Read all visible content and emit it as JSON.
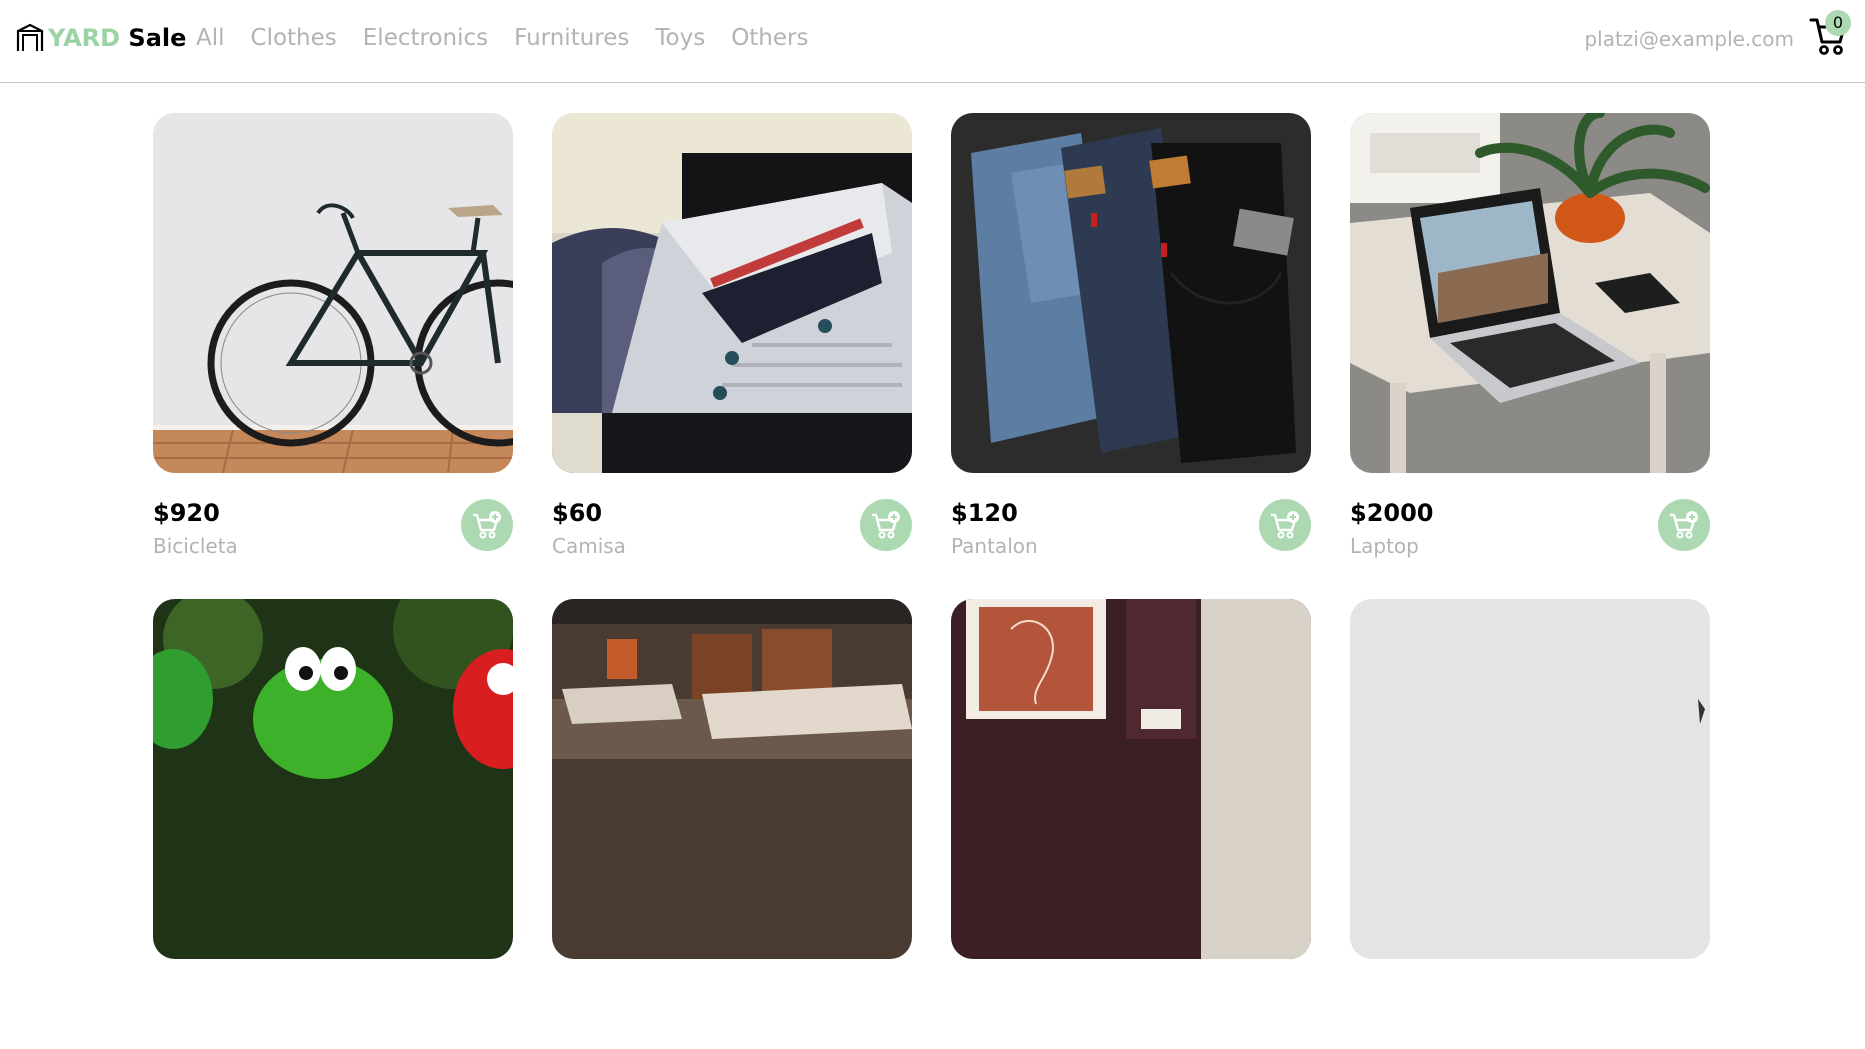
{
  "header": {
    "logo_yard": "YARD",
    "logo_sale": "Sale",
    "nav": [
      "All",
      "Clothes",
      "Electronics",
      "Furnitures",
      "Toys",
      "Others"
    ],
    "email": "platzi@example.com",
    "cart_count": "0"
  },
  "products": [
    {
      "price": "$920",
      "name": "Bicicleta"
    },
    {
      "price": "$60",
      "name": "Camisa"
    },
    {
      "price": "$120",
      "name": "Pantalon"
    },
    {
      "price": "$2000",
      "name": "Laptop"
    }
  ],
  "colors": {
    "accent": "#acd9b2",
    "muted_text": "#b3b3b3",
    "border": "#c8c8c8"
  }
}
